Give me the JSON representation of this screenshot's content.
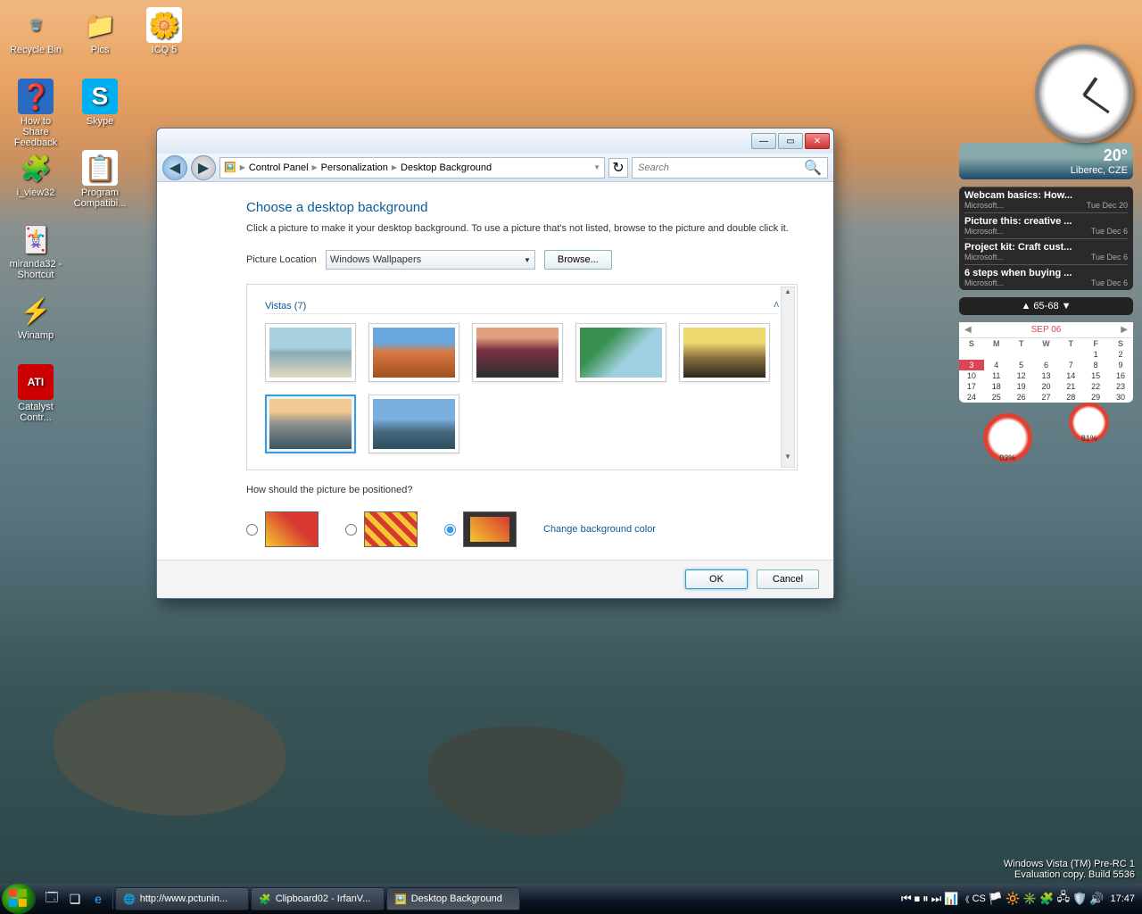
{
  "desktop_icons": [
    {
      "label": "Recycle Bin",
      "glyph": "🗑️",
      "bg": "transparent"
    },
    {
      "label": "Pics",
      "glyph": "📁",
      "bg": "transparent"
    },
    {
      "label": "ICQ 5",
      "glyph": "🌼",
      "bg": "#fff"
    },
    {
      "label": "How to Share Feedback",
      "glyph": "❓",
      "bg": "#2a6ac0"
    },
    {
      "label": "Skype",
      "glyph": "S",
      "bg": "#00aff0"
    },
    {
      "label": "i_view32",
      "glyph": "🧩",
      "bg": "transparent"
    },
    {
      "label": "Program Compatibi...",
      "glyph": "📋",
      "bg": "#fff"
    },
    {
      "label": "miranda32 - Shortcut",
      "glyph": "🃏",
      "bg": "transparent"
    },
    {
      "label": "Winamp",
      "glyph": "⚡",
      "bg": "transparent"
    },
    {
      "label": "Catalyst Contr...",
      "glyph": "ATI",
      "bg": "#cc0000"
    }
  ],
  "sidebar": {
    "weather": {
      "temp": "20°",
      "location": "Liberec, CZE"
    },
    "news": [
      {
        "title": "Webcam basics: How...",
        "src": "Microsoft...",
        "date": "Tue Dec 20"
      },
      {
        "title": "Picture this: creative ...",
        "src": "Microsoft...",
        "date": "Tue Dec 6"
      },
      {
        "title": "Project kit: Craft cust...",
        "src": "Microsoft...",
        "date": "Tue Dec 6"
      },
      {
        "title": "6 steps when buying ...",
        "src": "Microsoft...",
        "date": "Tue Dec 6"
      }
    ],
    "stock": "▲ 65-68 ▼",
    "calendar": {
      "month": "SEP 06",
      "days": [
        "S",
        "M",
        "T",
        "W",
        "T",
        "F",
        "S"
      ],
      "weeks": [
        [
          "",
          "",
          "",
          "",
          "",
          "1",
          "2"
        ],
        [
          "3",
          "4",
          "5",
          "6",
          "7",
          "8",
          "9"
        ],
        [
          "10",
          "11",
          "12",
          "13",
          "14",
          "15",
          "16"
        ],
        [
          "17",
          "18",
          "19",
          "20",
          "21",
          "22",
          "23"
        ],
        [
          "24",
          "25",
          "26",
          "27",
          "28",
          "29",
          "30"
        ]
      ],
      "today": "3"
    },
    "meter": {
      "left": "03%",
      "right": "81%"
    }
  },
  "window": {
    "breadcrumb": [
      "Control Panel",
      "Personalization",
      "Desktop Background"
    ],
    "search_placeholder": "Search",
    "heading": "Choose a desktop background",
    "description": "Click a picture to make it your desktop background. To use a picture that's not listed, browse to the picture and double click it.",
    "picture_location_label": "Picture Location",
    "picture_location_value": "Windows Wallpapers",
    "browse": "Browse...",
    "group_label": "Vistas (7)",
    "selected_thumb": 5,
    "position_label": "How should the picture be positioned?",
    "position_selected": 2,
    "change_color": "Change background color",
    "ok": "OK",
    "cancel": "Cancel"
  },
  "taskbar": {
    "tasks": [
      {
        "label": "http://www.pctunin...",
        "icon": "🌐"
      },
      {
        "label": "Clipboard02 - IrfanV...",
        "icon": "🧩"
      },
      {
        "label": "Desktop Background",
        "icon": "🖼️"
      }
    ],
    "lang": "CS",
    "time": "17:47"
  },
  "watermark": {
    "line1": "Windows Vista (TM) Pre-RC 1",
    "line2": "Evaluation copy. Build 5536"
  }
}
